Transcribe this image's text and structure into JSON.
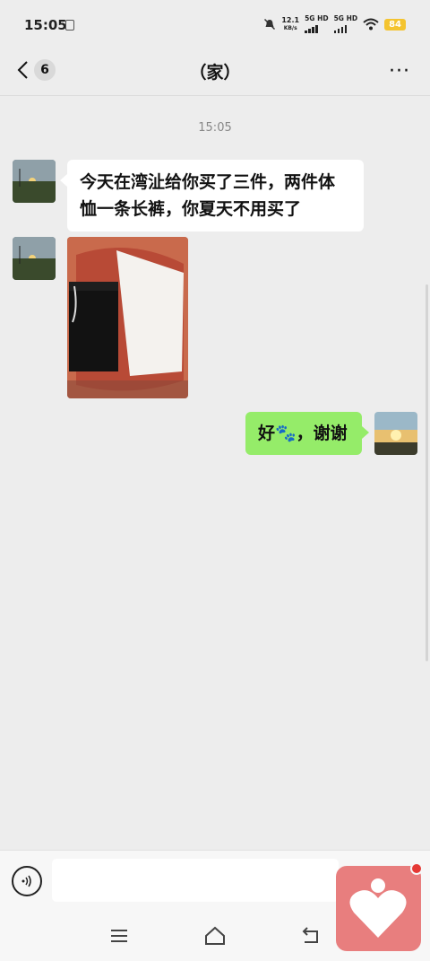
{
  "status": {
    "time": "15:05",
    "speed_value": "12.1",
    "speed_unit": "KB/s",
    "net1": "5G HD",
    "net2": "5G HD",
    "battery": "84"
  },
  "header": {
    "back_badge": "6",
    "title": "（家）",
    "more": "···"
  },
  "chat": {
    "timestamp": "15:05",
    "messages": [
      {
        "text": "今天在湾沚给你买了三件，两件体恤一条长裤，你夏天不用买了"
      },
      {
        "text": "好🐾，谢谢"
      }
    ]
  },
  "input": {
    "placeholder": ""
  },
  "colors": {
    "background": "#ededed",
    "outgoing_bubble": "#95ec69",
    "incoming_bubble": "#ffffff",
    "battery": "#f4c430",
    "floating_widget": "#e87e7e"
  },
  "icons": [
    "back-chevron-icon",
    "more-icon",
    "voice-icon",
    "menu-icon",
    "home-icon",
    "back-nav-icon",
    "heart-icon"
  ]
}
